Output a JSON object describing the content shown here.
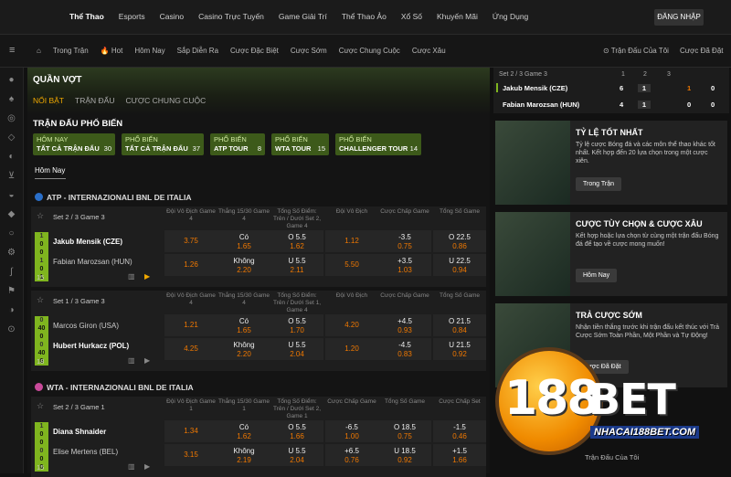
{
  "topnav": [
    "Thể Thao",
    "Esports",
    "Casino",
    "Casino Trực Tuyến",
    "Game Giải Trí",
    "Thể Thao Ảo",
    "Xổ Số",
    "Khuyến Mãi",
    "Ứng Dụng"
  ],
  "login": "ĐĂNG NHẬP",
  "subnav": [
    "Trong Trận",
    "🔥 Hot",
    "Hôm Nay",
    "Sắp Diễn Ra",
    "Cược Đặc Biệt",
    "Cược Sớm",
    "Cược Chung Cuộc",
    "Cược Xâu"
  ],
  "subnav_right": [
    "⊙ Trận Đấu Của Tôi",
    "Cược Đã Đặt"
  ],
  "main": {
    "title": "QUẦN VỢT",
    "tabs": [
      "NỔI BẬT",
      "TRẬN ĐẤU",
      "CƯỢC CHUNG CUỘC"
    ],
    "popular_title": "TRẬN ĐẤU PHỔ BIẾN",
    "pills": [
      {
        "a": "HÔM NAY",
        "b": "TẤT CẢ TRẬN ĐẤU",
        "n": "30"
      },
      {
        "a": "PHỔ BIẾN",
        "b": "TẤT CẢ TRẬN ĐẤU",
        "n": "37"
      },
      {
        "a": "PHỔ BIẾN",
        "b": "ATP TOUR",
        "n": "8"
      },
      {
        "a": "PHỔ BIẾN",
        "b": "WTA TOUR",
        "n": "15"
      },
      {
        "a": "PHỔ BIẾN",
        "b": "CHALLENGER TOUR",
        "n": "14"
      }
    ],
    "today": "Hôm Nay",
    "leagues": [
      "ATP - INTERNAZIONALI BNL DE ITALIA",
      "WTA - INTERNAZIONALI BNL DE ITALIA"
    ],
    "matches": [
      {
        "hd": "Set 2 / 3 Game 3",
        "p1": "Jakub Mensik (CZE)",
        "p2": "Fabian Marozsan (HUN)",
        "cnt": "15",
        "sc": [
          "1",
          "0",
          "0",
          "1",
          "0",
          "1"
        ],
        "cols": [
          "Đội Vô Địch Game 4",
          "Thắng 15/30 Game 4",
          "Tổng Số Điểm: Trên / Dưới Set 2, Game 4",
          "Đội Vô Địch",
          "Cược Chấp Game",
          "Tổng Số Game"
        ],
        "r1": [
          "",
          "3.75",
          "Có|1.65",
          "O 5.5|1.62",
          "",
          "1.12",
          "-3.5|0.75",
          "O 22.5|0.86"
        ],
        "r2": [
          "",
          "1.26",
          "Không|2.20",
          "U 5.5|2.11",
          "",
          "5.50",
          "+3.5|1.03",
          "U 22.5|0.94"
        ]
      },
      {
        "hd": "Set 1 / 3 Game 3",
        "p1": "Marcos Giron (USA)",
        "p2": "Hubert Hurkacz (POL)",
        "cnt": "18",
        "sc": [
          "0",
          "40",
          "0",
          "0",
          "40",
          "0"
        ],
        "cols": [
          "Đội Vô Địch Game 4",
          "Thắng 15/30 Game 4",
          "Tổng Số Điểm: Trên / Dưới Set 1, Game 4",
          "Đội Vô Địch",
          "Cược Chấp Game",
          "Tổng Số Game"
        ],
        "r1": [
          "",
          "1.21",
          "Có|1.65",
          "O 5.5|1.70",
          "",
          "4.20",
          "+4.5|0.93",
          "O 21.5|0.84"
        ],
        "r2": [
          "",
          "4.25",
          "Không|2.20",
          "U 5.5|2.04",
          "",
          "1.20",
          "-4.5|0.83",
          "U 21.5|0.92"
        ]
      },
      {
        "hd": "Set 2 / 3 Game 1",
        "p1": "Diana Shnaider",
        "p2": "Elise Mertens (BEL)",
        "cnt": "15",
        "sc": [
          "1",
          "0",
          "0",
          "0",
          "0",
          "0"
        ],
        "cols": [
          "Đội Vô Địch Game 1",
          "Thắng 15/30 Game 1",
          "Tổng Số Điểm: Trên / Dưới Set 2, Game 1",
          "Cược Chấp Game",
          "Tổng Số Game",
          "Cược Chấp Set"
        ],
        "r1": [
          "",
          "1.34",
          "Có|1.62",
          "O 5.5|1.66",
          "-6.5|1.00",
          "O 18.5|0.75",
          "-1.5|0.46"
        ],
        "r2": [
          "",
          "3.15",
          "Không|2.19",
          "U 5.5|2.04",
          "+6.5|0.76",
          "U 18.5|0.92",
          "+1.5|1.66"
        ]
      }
    ]
  },
  "live": {
    "hd": "Set 2 / 3 Game 3",
    "games": [
      "1",
      "2",
      "3"
    ],
    "p1": "Jakub Mensik (CZE)",
    "p2": "Fabian Marozsan (HUN)",
    "s1": [
      "6",
      "1",
      "1",
      "0"
    ],
    "s2": [
      "4",
      "1",
      "0",
      "0"
    ]
  },
  "promos": [
    {
      "title": "TỶ LỆ TỐT NHẤT",
      "desc": "Tỷ lệ cược Bóng đá và các môn thể thao khác tốt nhất. Kết hợp đến 20 lựa chọn trong một cược xiên.",
      "btn": "Trong Trận"
    },
    {
      "title": "CƯỢC TÙY CHỌN & CƯỢC XÂU",
      "desc": "Kết hợp hoặc lựa chọn từ cùng một trận đấu Bóng đá để tạo về cược mong muốn!",
      "btn": "Hôm Nay"
    },
    {
      "title": "TRẢ CƯỢC SỚM",
      "desc": "Nhận tiền thắng trước khi trận đấu kết thúc với Trả Cược Sớm Toàn Phần, Một Phần và Tự Động!",
      "btn": "Cược Đã Đặt"
    }
  ],
  "logo": {
    "n": "188",
    "b": "BET",
    "url": "NHACAI188BET.COM"
  },
  "right_bottom": "Trận Đấu Của Tôi"
}
